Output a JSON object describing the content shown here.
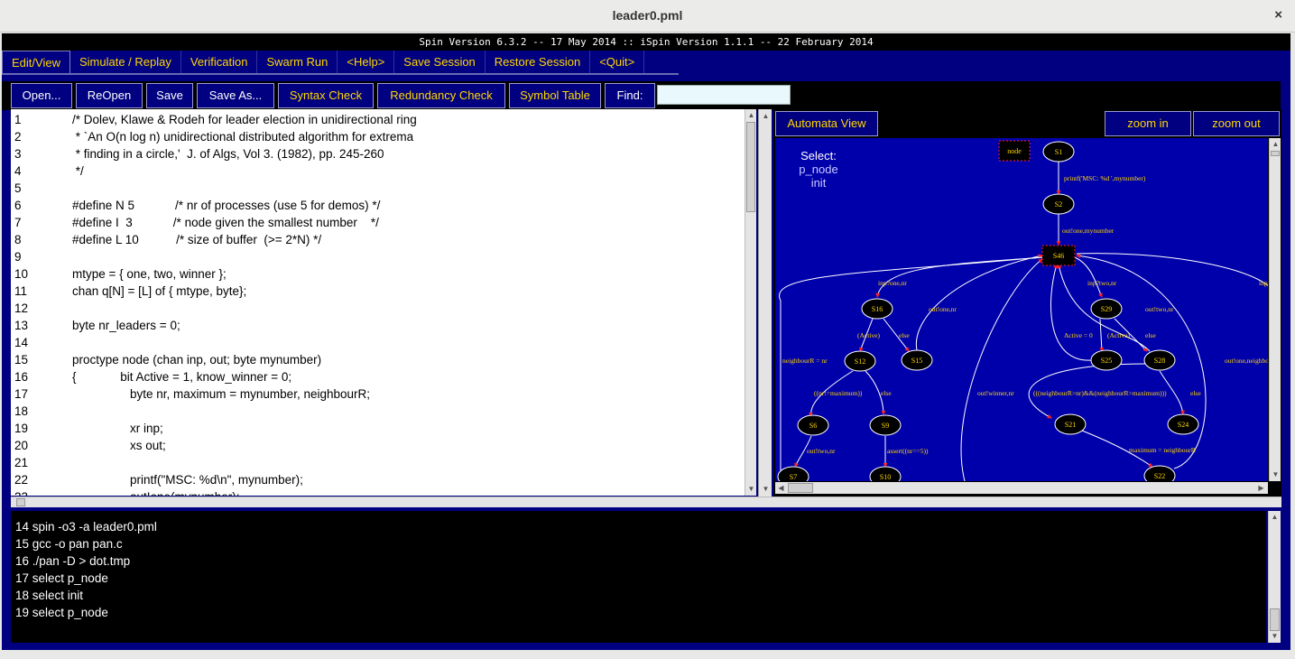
{
  "window": {
    "title": "leader0.pml",
    "close_label": "×"
  },
  "version_bar": "Spin Version 6.3.2 -- 17 May 2014 :: iSpin Version 1.1.1 -- 22 February 2014",
  "tabs": [
    {
      "label": "Edit/View",
      "active": true
    },
    {
      "label": "Simulate / Replay"
    },
    {
      "label": "Verification"
    },
    {
      "label": "Swarm Run"
    },
    {
      "label": "<Help>"
    },
    {
      "label": "Save Session"
    },
    {
      "label": "Restore Session"
    },
    {
      "label": "<Quit>"
    }
  ],
  "toolbar": {
    "open": "Open...",
    "reopen": "ReOpen",
    "save": "Save",
    "save_as": "Save As...",
    "syntax_check": "Syntax Check",
    "redundancy_check": "Redundancy Check",
    "symbol_table": "Symbol Table",
    "find": "Find:",
    "find_value": ""
  },
  "editor": {
    "lines": [
      {
        "n": "1",
        "t": "/* Dolev, Klawe & Rodeh for leader election in unidirectional ring",
        "i": 1
      },
      {
        "n": "2",
        "t": " * `An O(n log n) unidirectional distributed algorithm for extrema",
        "i": 1
      },
      {
        "n": "3",
        "t": " * finding in a circle,'  J. of Algs, Vol 3. (1982), pp. 245-260",
        "i": 1
      },
      {
        "n": "4",
        "t": " */",
        "i": 1
      },
      {
        "n": "5",
        "t": "",
        "i": 1
      },
      {
        "n": "6",
        "t": "#define N 5            /* nr of processes (use 5 for demos) */",
        "i": 1
      },
      {
        "n": "7",
        "t": "#define I  3            /* node given the smallest number    */",
        "i": 1
      },
      {
        "n": "8",
        "t": "#define L 10           /* size of buffer  (>= 2*N) */",
        "i": 1
      },
      {
        "n": "9",
        "t": "",
        "i": 1
      },
      {
        "n": "10",
        "t": "mtype = { one, two, winner };",
        "i": 1
      },
      {
        "n": "11",
        "t": "chan q[N] = [L] of { mtype, byte};",
        "i": 1
      },
      {
        "n": "12",
        "t": "",
        "i": 1
      },
      {
        "n": "13",
        "t": "byte nr_leaders = 0;",
        "i": 1
      },
      {
        "n": "14",
        "t": "",
        "i": 1
      },
      {
        "n": "15",
        "t": "proctype node (chan inp, out; byte mynumber)",
        "i": 1
      },
      {
        "n": "16",
        "t": "{             bit Active = 1, know_winner = 0;",
        "i": 1
      },
      {
        "n": "17",
        "t": "byte nr, maximum = mynumber, neighbourR;",
        "i": 2
      },
      {
        "n": "18",
        "t": "",
        "i": 2
      },
      {
        "n": "19",
        "t": "xr inp;",
        "i": 2
      },
      {
        "n": "20",
        "t": "xs out;",
        "i": 2
      },
      {
        "n": "21",
        "t": "",
        "i": 2
      },
      {
        "n": "22",
        "t": "printf(\"MSC: %d\\n\", mynumber);",
        "i": 2
      },
      {
        "n": "23",
        "t": "out!one(mynumber);",
        "i": 2
      }
    ]
  },
  "automata": {
    "button": "Automata View",
    "zoom_in": "zoom in",
    "zoom_out": "zoom out",
    "select_label": "Select:",
    "procs": [
      "p_node",
      "init"
    ],
    "legend_node": "node",
    "states": [
      "S1",
      "S2",
      "S46",
      "S16",
      "S15",
      "S12",
      "S6",
      "S9",
      "S7",
      "S10",
      "S29",
      "S25",
      "S28",
      "S21",
      "S24",
      "S22"
    ],
    "edge_labels": [
      "printf('MSC: %d ',mynumber)",
      "out!one,mynumber",
      "inp?one,nr",
      "out!one,nr",
      "(Active)",
      "else",
      "neighbourR = nr",
      "((nr!=maximum))",
      "else",
      "out!two,nr",
      "assert((nr==5))",
      "inp?two,nr",
      "out!two,nr",
      "Active = 0",
      "(Active)",
      "else",
      "out!winner,nr",
      "(((neighbourR>nr)&&(neighbourR>maximum)))",
      "else",
      "maximum = neighbourR",
      "out!one,neighbourR",
      "inp"
    ]
  },
  "console": {
    "lines": [
      "14 spin -o3 -a leader0.pml",
      "15 gcc -o pan pan.c",
      "16 ./pan -D > dot.tmp",
      "17 select p_node",
      "18 select init",
      "19 select p_node"
    ]
  }
}
